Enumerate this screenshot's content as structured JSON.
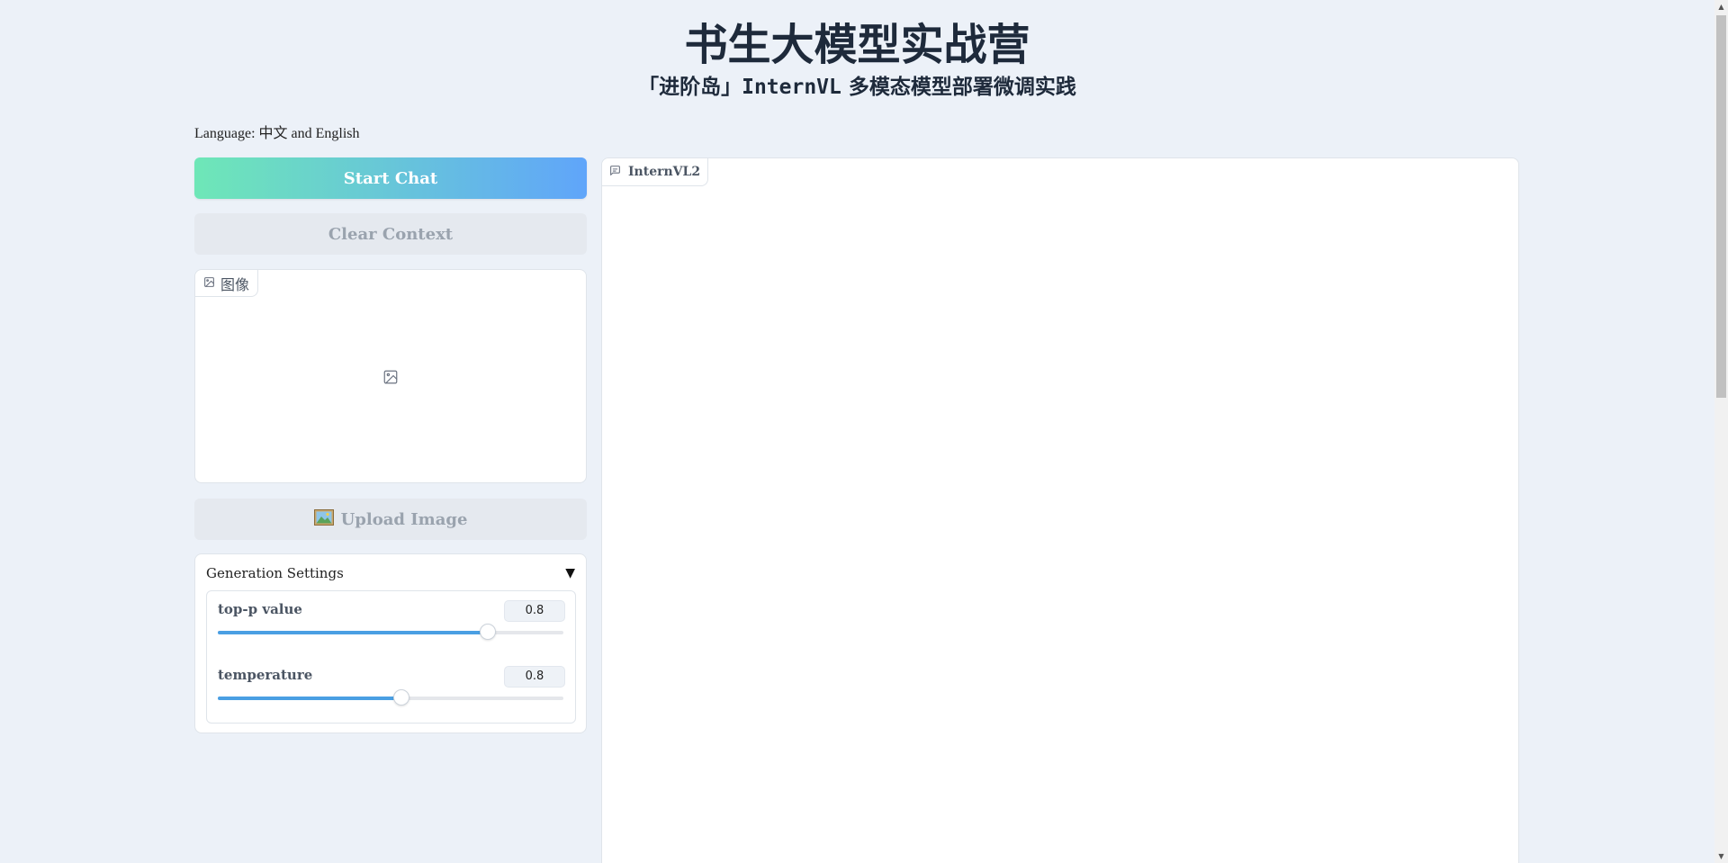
{
  "header": {
    "title": "书生大模型实战营",
    "subtitle_prefix": "「进阶岛」",
    "subtitle_mono": "InternVL",
    "subtitle_suffix": " 多模态模型部署微调实践"
  },
  "language_line": "Language: 中文 and English",
  "buttons": {
    "start_chat": "Start Chat",
    "clear_context": "Clear Context",
    "upload_image": "Upload Image"
  },
  "image_box": {
    "label": "图像",
    "icon": "image-icon"
  },
  "generation_settings": {
    "title": "Generation Settings",
    "expanded": true,
    "sliders": [
      {
        "label": "top-p value",
        "value": "0.8",
        "fraction": 0.78
      },
      {
        "label": "temperature",
        "value": "0.8",
        "fraction": 0.53
      }
    ]
  },
  "chat": {
    "label": "InternVL2",
    "icon": "chat-icon"
  },
  "colors": {
    "start_gradient_from": "#6ee7b7",
    "start_gradient_to": "#60a5fa",
    "slider_fill": "#4a9fe3",
    "background": "#ecf1f8"
  }
}
